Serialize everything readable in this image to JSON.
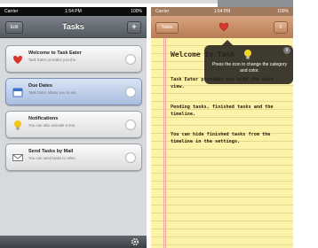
{
  "left": {
    "status": {
      "carrier": "Carrier",
      "time": "1:54 PM",
      "battery": "100%"
    },
    "nav": {
      "edit_label": "Edit",
      "title": "Tasks",
      "add_label": "+"
    },
    "cells": [
      {
        "title": "Welcome to Task Eater",
        "subtitle": "Task Eater provides you the",
        "icon": "heart-icon",
        "color": "#d9342b",
        "selected": false
      },
      {
        "title": "Due Dates",
        "subtitle": "Task Eater allows you to set",
        "icon": "calendar-icon",
        "color": "#3a6fc4",
        "selected": true
      },
      {
        "title": "Notifications",
        "subtitle": "You can also activate a text",
        "icon": "lightbulb-icon",
        "color": "#f3c619",
        "selected": false
      },
      {
        "title": "Send Tasks by Mail",
        "subtitle": "You can send tasks to other",
        "icon": "mail-icon",
        "color": "#ffffff",
        "selected": false
      }
    ]
  },
  "right": {
    "status": {
      "carrier": "Carrier",
      "time": "1:54 PM",
      "battery": "100%"
    },
    "nav": {
      "back_label": "Tasks",
      "heart_color": "#d9342b",
      "menu_label": "≡"
    },
    "tooltip": {
      "text": "Press the icon to change the category and color.",
      "close": "x"
    },
    "note": {
      "title": "Welcome to Task",
      "paragraphs": [
        "Task Eater provides you with the main view.",
        "Pending tasks, finished tasks and the timeline.",
        "You can hide finished tasks from the timeline in the settings."
      ]
    }
  },
  "colors": {
    "accent_red": "#d9342b",
    "paper": "#fdf3a8",
    "nav_brown": "#b77c55",
    "nav_gray": "#545a61"
  }
}
